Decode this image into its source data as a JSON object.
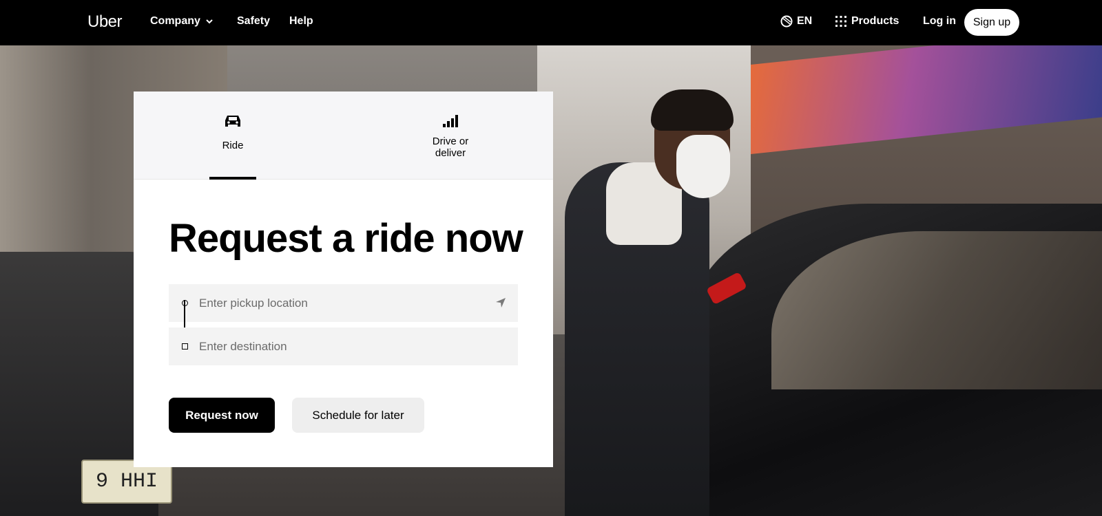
{
  "header": {
    "logo": "Uber",
    "nav": {
      "company": "Company",
      "safety": "Safety",
      "help": "Help",
      "language": "EN",
      "products": "Products",
      "login": "Log in",
      "signup": "Sign up"
    }
  },
  "hero": {
    "plate_text": "9 HHI"
  },
  "card": {
    "tabs": [
      {
        "label": "Ride",
        "icon": "car-icon",
        "active": true
      },
      {
        "label": "Drive or\ndeliver",
        "icon": "signal-bars-icon",
        "active": false
      }
    ],
    "title": "Request a ride now",
    "pickup_placeholder": "Enter pickup location",
    "destination_placeholder": "Enter destination",
    "request_button": "Request now",
    "schedule_button": "Schedule for later"
  },
  "colors": {
    "header_bg": "#000000",
    "primary_button": "#000000",
    "secondary_button": "#eeeeee",
    "field_bg": "#f3f3f3"
  }
}
